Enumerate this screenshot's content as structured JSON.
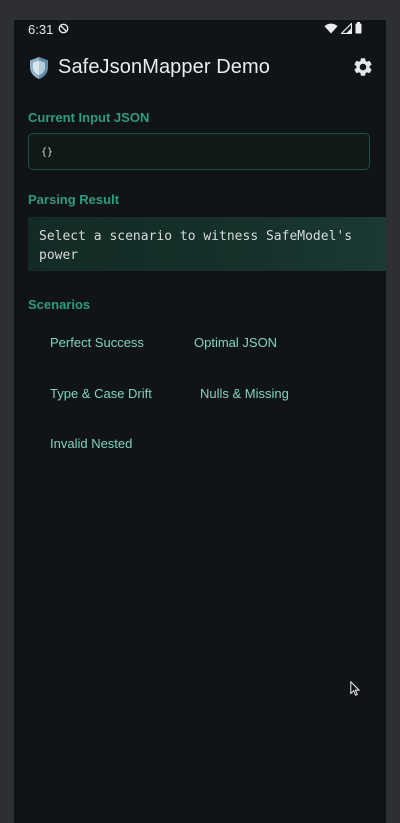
{
  "status_bar": {
    "time": "6:31"
  },
  "app_bar": {
    "title": "SafeJsonMapper Demo"
  },
  "input_section": {
    "label": "Current Input JSON",
    "json_value": "{}"
  },
  "result_section": {
    "label": "Parsing Result",
    "message": "Select a scenario to witness SafeModel's power"
  },
  "scenarios": {
    "label": "Scenarios",
    "items": [
      {
        "label": "Perfect Success"
      },
      {
        "label": "Optimal JSON"
      },
      {
        "label": "Type & Case Drift"
      },
      {
        "label": "Nulls & Missing"
      },
      {
        "label": "Invalid Nested"
      }
    ]
  },
  "colors": {
    "accent": "#2f9a80",
    "chip_text": "#7fd3c0",
    "background": "#111416"
  },
  "icons": {
    "logo": "shield-icon",
    "settings": "gear-icon"
  }
}
